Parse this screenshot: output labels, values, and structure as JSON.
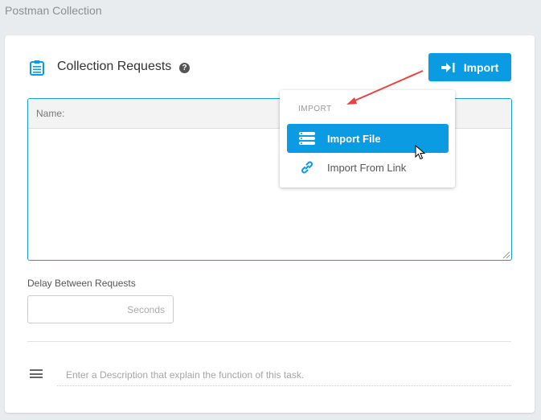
{
  "page": {
    "title": "Postman Collection"
  },
  "section": {
    "title": "Collection Requests",
    "icon": "clipboard-list-icon",
    "help_icon": "question-circle-icon",
    "help_glyph": "?"
  },
  "import_button": {
    "label": "Import",
    "icon": "sign-in-arrow-icon"
  },
  "requests_table": {
    "header": "Name:"
  },
  "delay": {
    "label": "Delay Between Requests",
    "value": "",
    "placeholder": "Seconds"
  },
  "description": {
    "icon": "menu-lines-icon",
    "value": "",
    "placeholder": "Enter a Description that explain the function of this task."
  },
  "import_menu": {
    "header": "IMPORT",
    "items": [
      {
        "label": "Import File",
        "icon": "server-stack-icon",
        "active": true
      },
      {
        "label": "Import From Link",
        "icon": "link-icon",
        "active": false
      }
    ]
  },
  "colors": {
    "accent": "#0b9be3",
    "annotation_arrow": "#e8423f",
    "background": "#e9ecef"
  }
}
